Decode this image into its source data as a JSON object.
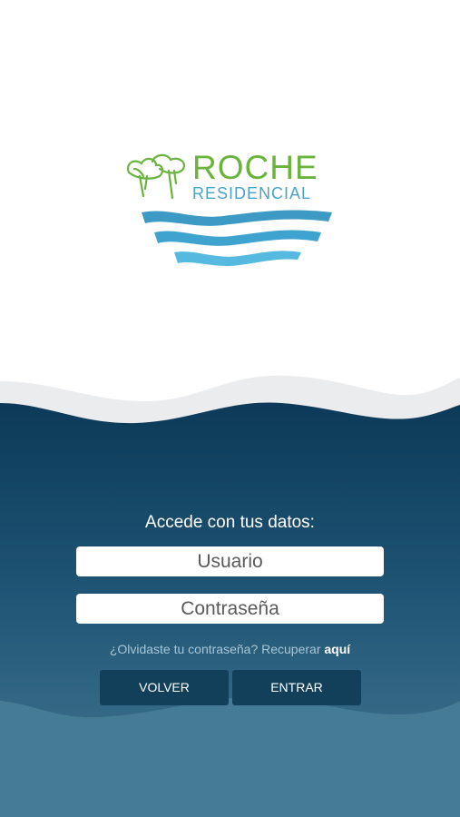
{
  "logo": {
    "title": "ROCHE",
    "subtitle": "RESIDENCIAL"
  },
  "login": {
    "heading": "Accede con tus datos:",
    "username_placeholder": "Usuario",
    "password_placeholder": "Contraseña",
    "forgot_text": "¿Olvidaste tu contraseña? Recuperar ",
    "forgot_link": "aquí",
    "back_label": "VOLVER",
    "enter_label": "ENTRAR"
  },
  "colors": {
    "brand_green": "#6ab43e",
    "brand_blue": "#4aa3c8",
    "background_dark": "#0e3d5a",
    "button": "#123f5a"
  }
}
